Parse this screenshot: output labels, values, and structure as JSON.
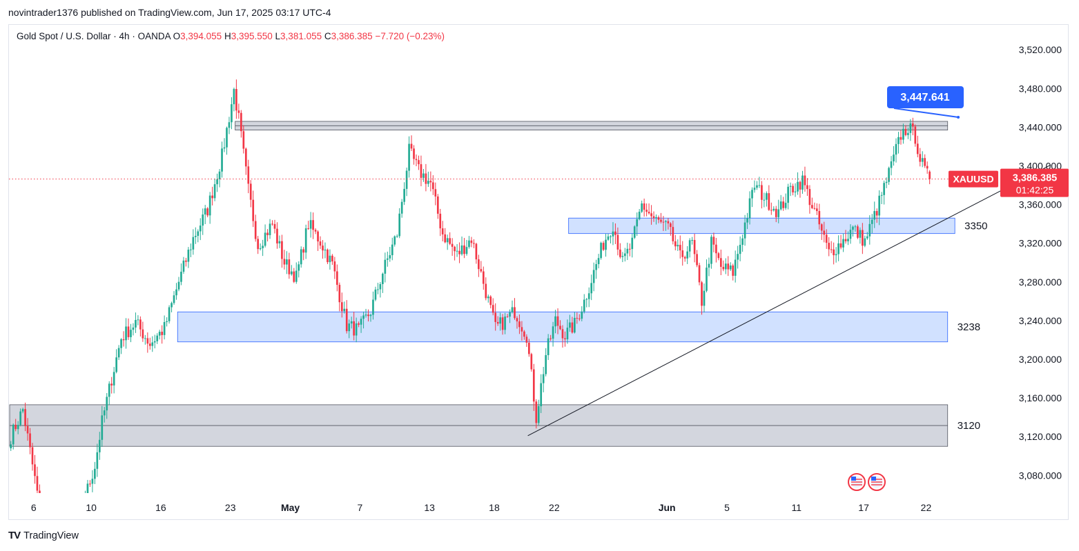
{
  "header": {
    "published": "novintrader1376 published on TradingView.com, Jun 17, 2025 03:17 UTC-4"
  },
  "legend": {
    "symbol": "Gold Spot / U.S. Dollar · 4h · OANDA",
    "o_label": "O",
    "o_value": "3,394.055",
    "h_label": "H",
    "h_value": "3,395.550",
    "l_label": "L",
    "l_value": "3,381.055",
    "c_label": "C",
    "c_value": "3,386.385",
    "change": "−7.720 (−0.23%)"
  },
  "footer": {
    "logo_mark": "TV",
    "brand": "TradingView"
  },
  "colors": {
    "up": "#22ab94",
    "down": "#f23645",
    "zone_blue": "#c9dcff",
    "zone_gray": "#d1d4dc",
    "callout": "#2962ff"
  },
  "chart_data": {
    "type": "candlestick",
    "symbol": "XAUUSD",
    "timeframe": "4h",
    "ylim": [
      3060,
      3545
    ],
    "y_ticks": [
      3080,
      3120,
      3160,
      3200,
      3240,
      3280,
      3320,
      3360,
      3400,
      3440,
      3480,
      3520
    ],
    "y_tick_labels": [
      "3,080.000",
      "3,120.000",
      "3,160.000",
      "3,200.000",
      "3,240.000",
      "3,280.000",
      "3,320.000",
      "3,360.000",
      "3,400.000",
      "3,440.000",
      "3,480.000",
      "3,520.000"
    ],
    "x_ticks": [
      {
        "label": "6",
        "bar": 10
      },
      {
        "label": "10",
        "bar": 34
      },
      {
        "label": "16",
        "bar": 63
      },
      {
        "label": "23",
        "bar": 92
      },
      {
        "label": "May",
        "bar": 117
      },
      {
        "label": "7",
        "bar": 146
      },
      {
        "label": "13",
        "bar": 175
      },
      {
        "label": "18",
        "bar": 202
      },
      {
        "label": "22",
        "bar": 227
      },
      {
        "label": "Jun",
        "bar": 274
      },
      {
        "label": "5",
        "bar": 299
      },
      {
        "label": "11",
        "bar": 328
      },
      {
        "label": "17",
        "bar": 356
      },
      {
        "label": "22",
        "bar": 382
      }
    ],
    "last_price": 3386.385,
    "last_price_label": "3,386.385",
    "countdown": "01:42:25",
    "symbol_tag": "XAUUSD",
    "zones": [
      {
        "name": "resistance-zone",
        "bar_from": 94,
        "bar_to": 391,
        "low": 3437,
        "high": 3446,
        "color": "gray",
        "label": ""
      },
      {
        "name": "zone-3350",
        "bar_from": 233,
        "bar_to": 394,
        "low": 3330,
        "high": 3346,
        "color": "blue",
        "label": "3350"
      },
      {
        "name": "zone-3238",
        "bar_from": 70,
        "bar_to": 391,
        "low": 3218,
        "high": 3249,
        "color": "blue",
        "label": "3238"
      },
      {
        "name": "zone-3120",
        "bar_from": 0,
        "bar_to": 391,
        "low": 3110,
        "high": 3153,
        "color": "gray",
        "label": "3120"
      }
    ],
    "trendline": {
      "bar_from": 216,
      "price_from": 3121,
      "bar_to": 434,
      "price_to": 3401
    },
    "callout": {
      "label": "3,447.641",
      "bar": 396,
      "price": 3446
    },
    "anchors": [
      {
        "bar": 0,
        "price": 3120
      },
      {
        "bar": 5,
        "price": 3148
      },
      {
        "bar": 8,
        "price": 3105
      },
      {
        "bar": 11,
        "price": 3062
      },
      {
        "bar": 14,
        "price": 3030
      },
      {
        "bar": 20,
        "price": 3000
      },
      {
        "bar": 25,
        "price": 3012
      },
      {
        "bar": 30,
        "price": 3050
      },
      {
        "bar": 35,
        "price": 3090
      },
      {
        "bar": 38,
        "price": 3135
      },
      {
        "bar": 42,
        "price": 3180
      },
      {
        "bar": 46,
        "price": 3222
      },
      {
        "bar": 52,
        "price": 3238
      },
      {
        "bar": 58,
        "price": 3216
      },
      {
        "bar": 64,
        "price": 3232
      },
      {
        "bar": 70,
        "price": 3280
      },
      {
        "bar": 76,
        "price": 3325
      },
      {
        "bar": 82,
        "price": 3355
      },
      {
        "bar": 88,
        "price": 3410
      },
      {
        "bar": 93,
        "price": 3478
      },
      {
        "bar": 95,
        "price": 3448
      },
      {
        "bar": 99,
        "price": 3375
      },
      {
        "bar": 103,
        "price": 3318
      },
      {
        "bar": 109,
        "price": 3340
      },
      {
        "bar": 114,
        "price": 3300
      },
      {
        "bar": 119,
        "price": 3285
      },
      {
        "bar": 124,
        "price": 3340
      },
      {
        "bar": 129,
        "price": 3322
      },
      {
        "bar": 134,
        "price": 3298
      },
      {
        "bar": 140,
        "price": 3235
      },
      {
        "bar": 145,
        "price": 3230
      },
      {
        "bar": 150,
        "price": 3250
      },
      {
        "bar": 155,
        "price": 3290
      },
      {
        "bar": 161,
        "price": 3330
      },
      {
        "bar": 166,
        "price": 3415
      },
      {
        "bar": 170,
        "price": 3395
      },
      {
        "bar": 175,
        "price": 3382
      },
      {
        "bar": 180,
        "price": 3330
      },
      {
        "bar": 186,
        "price": 3308
      },
      {
        "bar": 192,
        "price": 3325
      },
      {
        "bar": 198,
        "price": 3270
      },
      {
        "bar": 202,
        "price": 3232
      },
      {
        "bar": 206,
        "price": 3240
      },
      {
        "bar": 210,
        "price": 3250
      },
      {
        "bar": 215,
        "price": 3225
      },
      {
        "bar": 219,
        "price": 3140
      },
      {
        "bar": 223,
        "price": 3205
      },
      {
        "bar": 227,
        "price": 3240
      },
      {
        "bar": 231,
        "price": 3225
      },
      {
        "bar": 235,
        "price": 3236
      },
      {
        "bar": 239,
        "price": 3260
      },
      {
        "bar": 243,
        "price": 3290
      },
      {
        "bar": 247,
        "price": 3320
      },
      {
        "bar": 251,
        "price": 3340
      },
      {
        "bar": 255,
        "price": 3300
      },
      {
        "bar": 259,
        "price": 3320
      },
      {
        "bar": 263,
        "price": 3360
      },
      {
        "bar": 268,
        "price": 3345
      },
      {
        "bar": 274,
        "price": 3335
      },
      {
        "bar": 279,
        "price": 3305
      },
      {
        "bar": 284,
        "price": 3320
      },
      {
        "bar": 288,
        "price": 3260
      },
      {
        "bar": 292,
        "price": 3320
      },
      {
        "bar": 296,
        "price": 3295
      },
      {
        "bar": 301,
        "price": 3290
      },
      {
        "bar": 306,
        "price": 3340
      },
      {
        "bar": 310,
        "price": 3380
      },
      {
        "bar": 315,
        "price": 3365
      },
      {
        "bar": 320,
        "price": 3352
      },
      {
        "bar": 325,
        "price": 3376
      },
      {
        "bar": 330,
        "price": 3385
      },
      {
        "bar": 336,
        "price": 3346
      },
      {
        "bar": 341,
        "price": 3310
      },
      {
        "bar": 346,
        "price": 3320
      },
      {
        "bar": 351,
        "price": 3335
      },
      {
        "bar": 356,
        "price": 3322
      },
      {
        "bar": 361,
        "price": 3355
      },
      {
        "bar": 366,
        "price": 3392
      },
      {
        "bar": 371,
        "price": 3432
      },
      {
        "bar": 374,
        "price": 3440
      },
      {
        "bar": 377,
        "price": 3430
      },
      {
        "bar": 379,
        "price": 3408
      },
      {
        "bar": 381,
        "price": 3394
      },
      {
        "bar": 383,
        "price": 3386
      }
    ]
  }
}
